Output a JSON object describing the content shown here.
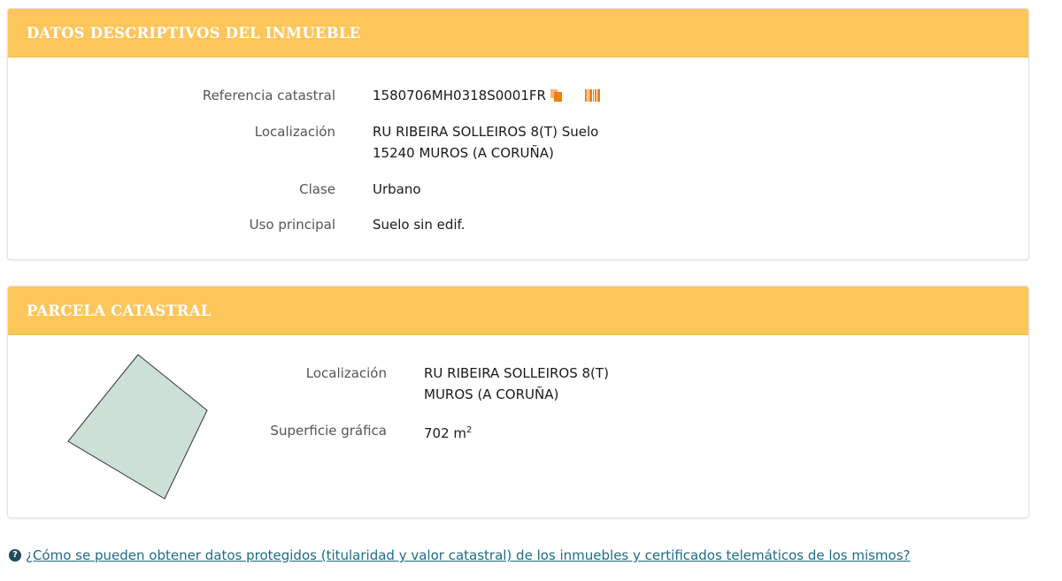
{
  "inmueble": {
    "title": "DATOS DESCRIPTIVOS DEL INMUEBLE",
    "referencia_label": "Referencia catastral",
    "referencia_value": "1580706MH0318S0001FR",
    "localizacion_label": "Localización",
    "localizacion_line1": "RU RIBEIRA SOLLEIROS 8(T) Suelo",
    "localizacion_line2": "15240 MUROS (A CORUÑA)",
    "clase_label": "Clase",
    "clase_value": "Urbano",
    "uso_label": "Uso principal",
    "uso_value": "Suelo sin edif.",
    "icons": [
      "copy-icon",
      "barcode-icon"
    ],
    "icon_color": "#f07f12"
  },
  "parcela": {
    "title": "PARCELA CATASTRAL",
    "localizacion_label": "Localización",
    "localizacion_line1": "RU RIBEIRA SOLLEIROS 8(T)",
    "localizacion_line2": "MUROS (A CORUÑA)",
    "superficie_label": "Superficie gráfica",
    "superficie_value": "702 m",
    "superficie_unit_sup": "2",
    "shape_fill": "#cde0d7"
  },
  "help": {
    "icon": "question-circle-icon",
    "icon_glyph": "?",
    "link_text": "¿Cómo se pueden obtener datos protegidos (titularidad y valor catastral) de los inmuebles y certificados telemáticos de los mismos?"
  },
  "colors": {
    "header_bg": "#fdc65b",
    "header_text": "#ffffff",
    "link": "#1d6b86"
  }
}
